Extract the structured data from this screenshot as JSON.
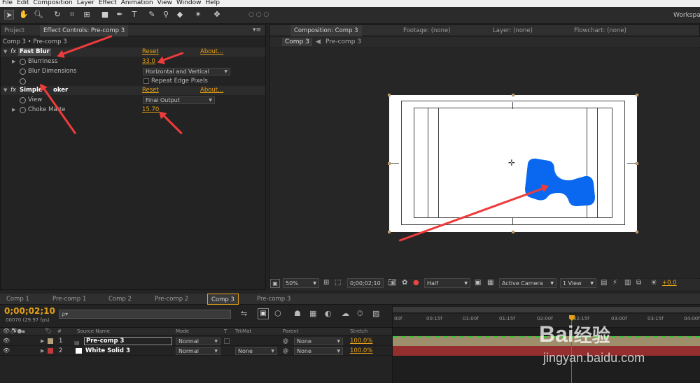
{
  "menubar": [
    "File",
    "Edit",
    "Composition",
    "Layer",
    "Effect",
    "Animation",
    "View",
    "Window",
    "Help"
  ],
  "toolbar": {
    "workspace_label": "Workspac"
  },
  "left_panel": {
    "tabs": [
      "Project",
      "Effect Controls: Pre-comp 3"
    ],
    "breadcrumb": "Comp 3 • Pre-comp 3",
    "effects": [
      {
        "name": "Fast Blur",
        "reset": "Reset",
        "about": "About...",
        "props": [
          {
            "label": "Blurriness",
            "value": "33.0"
          },
          {
            "label": "Blur Dimensions",
            "value": "Horizontal and Vertical"
          },
          {
            "label": "",
            "checkbox_label": "Repeat Edge Pixels"
          }
        ]
      },
      {
        "name": "Simple Choker",
        "name_visible": "Simple",
        "name_tail": "oker",
        "reset": "Reset",
        "about": "About...",
        "props": [
          {
            "label": "View",
            "value": "Final Output"
          },
          {
            "label": "Choke Matte",
            "value": "15.70"
          }
        ]
      }
    ]
  },
  "comp_panel": {
    "tabs": [
      "Composition: Comp 3",
      "Footage: (none)",
      "Layer: (none)",
      "Flowchart: (none)"
    ],
    "subtabs": [
      "Comp 3",
      "Pre-comp 3"
    ],
    "footer": {
      "zoom": "50%",
      "timecode": "0;00;02;10",
      "resolution": "Half",
      "camera": "Active Camera",
      "view": "1 View",
      "exposure": "+0.0"
    },
    "shape_color": "#0a68f0"
  },
  "timeline": {
    "tabs": [
      "Comp 1",
      "Pre-comp 1",
      "Comp 2",
      "Pre-comp 2",
      "Comp 3",
      "Pre-comp 3"
    ],
    "timecode": "0;00;02;10",
    "fps": "00070 (29.97 fps)",
    "search_placeholder": "ρ▾",
    "columns": [
      "#",
      "Source Name",
      "Mode",
      "T",
      "TrkMat",
      "Parent",
      "Stretch"
    ],
    "ruler": [
      "00f",
      "00:15f",
      "01:00f",
      "01:15f",
      "02:00f",
      "02:15f",
      "03:00f",
      "03:15f",
      "04:00f"
    ],
    "playhead_label": "02:15f",
    "layers": [
      {
        "num": "1",
        "name": "Pre-comp 3",
        "mode": "Normal",
        "trkmat": "",
        "parent": "None",
        "stretch": "100.0%",
        "color": "#b5a27a"
      },
      {
        "num": "2",
        "name": "White Solid 3",
        "mode": "Normal",
        "trkmat": "None",
        "parent": "None",
        "stretch": "100.0%",
        "color": "#c23a3a"
      }
    ]
  },
  "watermark": {
    "brand": "Bai",
    "brand2": "经验",
    "url": "jingyan.baidu.com"
  }
}
